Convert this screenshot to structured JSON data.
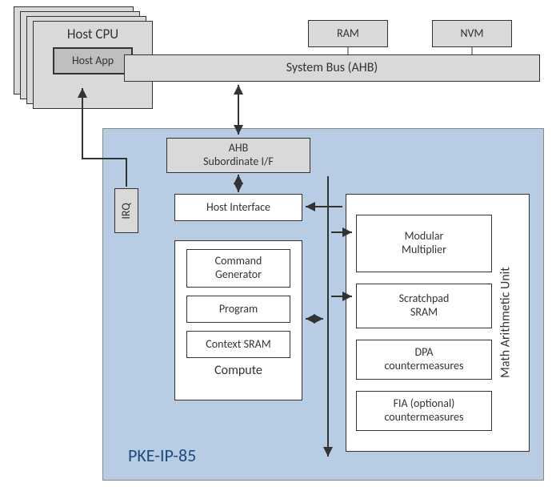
{
  "host_cpu": {
    "title": "Host CPU",
    "app": "Host App"
  },
  "ram": "RAM",
  "nvm": "NVM",
  "system_bus": "System Bus (AHB)",
  "irq": "IRQ",
  "pke": {
    "label": "PKE-IP-85",
    "ahb_sub": "AHB\nSubordinate I/F",
    "host_if": "Host Interface",
    "compute": {
      "label": "Compute",
      "cmd_gen": "Command\nGenerator",
      "program": "Program",
      "ctx_sram": "Context SRAM"
    },
    "mau": {
      "label": "Math Arithmetic Unit",
      "mod_mult": "Modular\nMultiplier",
      "scratchpad": "Scratchpad\nSRAM",
      "dpa": "DPA\ncountermeasures",
      "fia": "FIA (optional)\ncountermeasures"
    }
  }
}
